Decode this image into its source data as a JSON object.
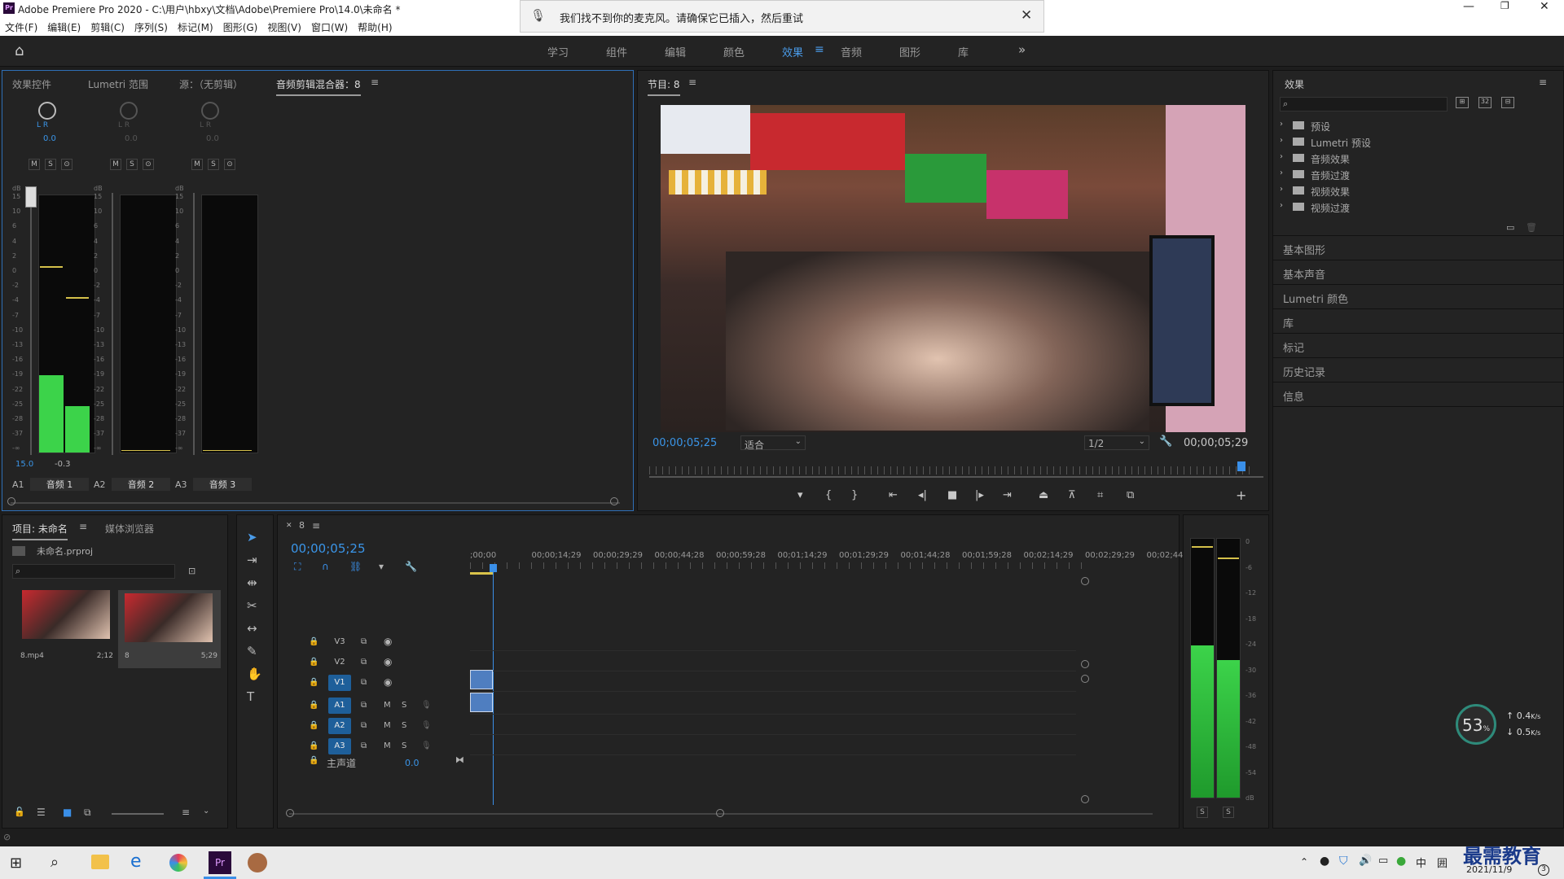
{
  "window": {
    "title": "Adobe Premiere Pro 2020 - C:\\用户\\hbxy\\文档\\Adobe\\Premiere Pro\\14.0\\未命名 *",
    "app_icon": "Pr"
  },
  "notification": {
    "text": "我们找不到你的麦克风。请确保它已插入，然后重试",
    "icon": "microphone-icon"
  },
  "menu": [
    "文件(F)",
    "编辑(E)",
    "剪辑(C)",
    "序列(S)",
    "标记(M)",
    "图形(G)",
    "视图(V)",
    "窗口(W)",
    "帮助(H)"
  ],
  "workspaces": [
    "学习",
    "组件",
    "编辑",
    "颜色",
    "效果",
    "音频",
    "图形",
    "库"
  ],
  "active_workspace": "效果",
  "left_panel": {
    "tabs": [
      "效果控件",
      "Lumetri 范围",
      "源：（无剪辑）",
      "音频剪辑混合器：8"
    ],
    "active_tab": "音频剪辑混合器：8",
    "channels": [
      {
        "lr": "L R",
        "pan": "0.0",
        "level": "15.0",
        "peak": "-0.3",
        "track": "A1",
        "name": "音频 1"
      },
      {
        "lr": "L R",
        "pan": "0.0",
        "track": "A2",
        "name": "音频 2"
      },
      {
        "lr": "L R",
        "pan": "0.0",
        "track": "A3",
        "name": "音频 3"
      }
    ],
    "ms_buttons": [
      "M",
      "S",
      "⊙"
    ],
    "db_label": "dB",
    "db_scale": [
      "15",
      "10",
      "6",
      "4",
      "2",
      "0",
      "-2",
      "-4",
      "-7",
      "-10",
      "-13",
      "-16",
      "-19",
      "-22",
      "-25",
      "-28",
      "-37",
      "-∞"
    ]
  },
  "program": {
    "title": "节目: 8",
    "timecode_in": "00;00;05;25",
    "fit": "适合",
    "quality": "1/2",
    "timecode_out": "00;00;05;29"
  },
  "effects_panel": {
    "title": "效果",
    "tree": [
      "预设",
      "Lumetri 预设",
      "音频效果",
      "音频过渡",
      "视频效果",
      "视频过渡"
    ],
    "sections": [
      "基本图形",
      "基本声音",
      "Lumetri 颜色",
      "库",
      "标记",
      "历史记录",
      "信息"
    ]
  },
  "project": {
    "tabs": [
      "项目: 未命名",
      "媒体浏览器"
    ],
    "filename": "未命名.prproj",
    "items": [
      {
        "name": "8.mp4",
        "duration": "2;12"
      },
      {
        "name": "8",
        "duration": "5;29"
      }
    ]
  },
  "timeline": {
    "tab": "8",
    "timecode": "00;00;05;25",
    "ruler": [
      ";00;00",
      "00;00;14;29",
      "00;00;29;29",
      "00;00;44;28",
      "00;00;59;28",
      "00;01;14;29",
      "00;01;29;29",
      "00;01;44;28",
      "00;01;59;28",
      "00;02;14;29",
      "00;02;29;29",
      "00;02;44;"
    ],
    "video_tracks": [
      "V3",
      "V2",
      "V1"
    ],
    "audio_tracks": [
      "A1",
      "A2",
      "A3"
    ],
    "master": {
      "label": "主声道",
      "value": "0.0"
    }
  },
  "audio_meter": {
    "scale": [
      "0",
      "-6",
      "-12",
      "-18",
      "-24",
      "-30",
      "-36",
      "-42",
      "-48",
      "-54",
      "dB"
    ],
    "solo": [
      "S",
      "S"
    ]
  },
  "net_widget": {
    "percent": "53",
    "unit": "%",
    "up": "0.4",
    "down": "0.5",
    "rate_unit": "K/s"
  },
  "taskbar": {
    "ime": "中",
    "date": "2021/11/9",
    "badge": "3"
  },
  "watermark": "最需教育"
}
